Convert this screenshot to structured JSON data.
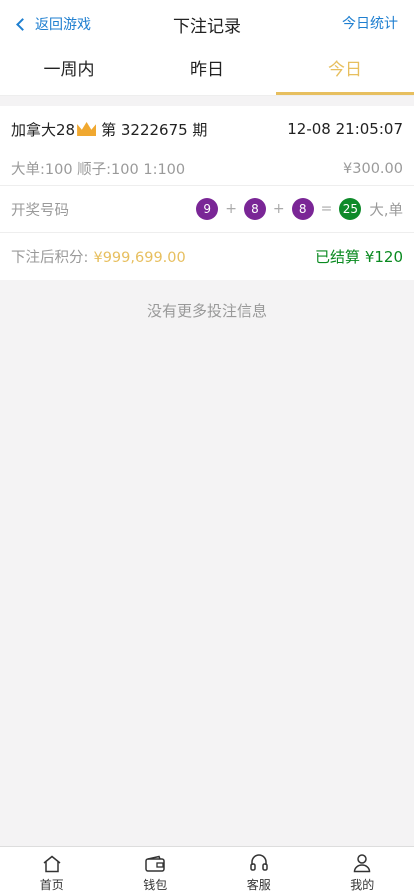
{
  "header": {
    "back_label": "返回游戏",
    "title": "下注记录",
    "right_label": "今日统计"
  },
  "tabs": [
    {
      "label": "一周内",
      "active": false
    },
    {
      "label": "昨日",
      "active": false
    },
    {
      "label": "今日",
      "active": true
    }
  ],
  "bet": {
    "lottery_name": "加拿大28",
    "period_text": "第 3222675 期",
    "datetime": "12-08 21:05:07",
    "detail": "大单:100 顺子:100 1:100",
    "amount": "¥300.00",
    "draw_label": "开奖号码",
    "balls": [
      "9",
      "8",
      "8"
    ],
    "op_plus": "+",
    "op_equal": "=",
    "sum": "25",
    "result": "大,单",
    "points_label": "下注后积分:",
    "points_value": "¥999,699.00",
    "settled_text": "已结算 ¥120"
  },
  "no_more": "没有更多投注信息",
  "tabbar": [
    {
      "label": "首页",
      "icon": "home-icon"
    },
    {
      "label": "钱包",
      "icon": "wallet-icon"
    },
    {
      "label": "客服",
      "icon": "headset-icon"
    },
    {
      "label": "我的",
      "icon": "user-icon"
    }
  ],
  "colors": {
    "accent": "#e7bf5f",
    "link": "#1f7fd0",
    "ball_purple": "#7a2696",
    "ball_green": "#0e8a2a",
    "settled": "#0a8a20"
  }
}
